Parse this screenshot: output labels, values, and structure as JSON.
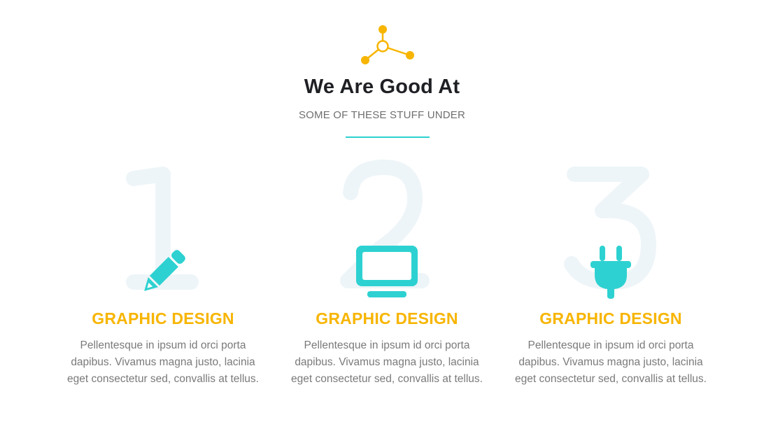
{
  "header": {
    "icon": "molecule-icon",
    "title": "We Are Good At",
    "subtitle": "SOME OF THESE STUFF UNDER"
  },
  "colors": {
    "accent_yellow": "#f7b500",
    "accent_teal": "#2ed1d1",
    "number_watermark": "#eef5f8"
  },
  "features": [
    {
      "number": "1",
      "icon": "pencil-icon",
      "title": "GRAPHIC DESIGN",
      "desc_lines": [
        "Pellentesque in ipsum id orci porta",
        "dapibus. Vivamus magna justo, lacinia",
        "eget consectetur sed, convallis at tellus."
      ]
    },
    {
      "number": "2",
      "icon": "monitor-icon",
      "title": "GRAPHIC DESIGN",
      "desc_lines": [
        "Pellentesque in ipsum id orci porta",
        "dapibus. Vivamus magna justo, lacinia",
        "eget consectetur sed, convallis at tellus."
      ]
    },
    {
      "number": "3",
      "icon": "plug-icon",
      "title": "GRAPHIC DESIGN",
      "desc_lines": [
        "Pellentesque in ipsum id orci porta",
        "dapibus. Vivamus magna justo, lacinia",
        "eget consectetur sed, convallis at tellus."
      ]
    }
  ]
}
